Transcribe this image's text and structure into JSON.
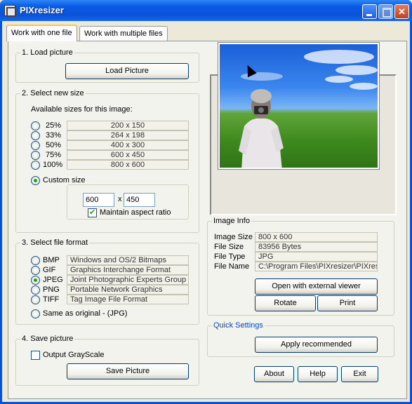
{
  "window": {
    "title": "PIXresizer"
  },
  "tabs": [
    {
      "label": "Work with one file",
      "active": true
    },
    {
      "label": "Work with multiple files",
      "active": false
    }
  ],
  "load": {
    "legend": "1. Load picture",
    "button": "Load Picture"
  },
  "size": {
    "legend": "2. Select new size",
    "caption": "Available sizes for this image:",
    "options": [
      {
        "pct": "25%",
        "dims": "200  x  150",
        "checked": false
      },
      {
        "pct": "33%",
        "dims": "264  x  198",
        "checked": false
      },
      {
        "pct": "50%",
        "dims": "400  x  300",
        "checked": false
      },
      {
        "pct": "75%",
        "dims": "600  x  450",
        "checked": false
      },
      {
        "pct": "100%",
        "dims": "800  x  600",
        "checked": false
      }
    ],
    "custom_label": "Custom size",
    "custom_checked": true,
    "custom_width": "600",
    "custom_x": "x",
    "custom_height": "450",
    "maintain_label": "Maintain aspect ratio",
    "maintain_checked": true
  },
  "format": {
    "legend": "3. Select file format",
    "options": [
      {
        "ext": "BMP",
        "desc": "Windows and OS/2 Bitmaps",
        "checked": false
      },
      {
        "ext": "GIF",
        "desc": "Graphics Interchange Format",
        "checked": false
      },
      {
        "ext": "JPEG",
        "desc": "Joint Photographic Experts Group",
        "checked": true
      },
      {
        "ext": "PNG",
        "desc": "Portable Network Graphics",
        "checked": false
      },
      {
        "ext": "TIFF",
        "desc": "Tag Image File Format",
        "checked": false
      }
    ],
    "same_as_original": "Same as original  - (JPG)"
  },
  "save": {
    "legend": "4. Save picture",
    "grayscale_label": "Output GrayScale",
    "button": "Save Picture"
  },
  "info": {
    "legend": "Image Info",
    "rows": [
      {
        "key": "Image Size",
        "value": "800 x 600"
      },
      {
        "key": "File Size",
        "value": "83956 Bytes"
      },
      {
        "key": "File Type",
        "value": "JPG"
      },
      {
        "key": "File Name",
        "value": "C:\\Program Files\\PIXresizer\\PIXresiz"
      }
    ],
    "open_button": "Open with external viewer",
    "rotate_button": "Rotate",
    "print_button": "Print"
  },
  "quick": {
    "legend": "Quick Settings",
    "button": "Apply recommended"
  },
  "footer": {
    "about": "About",
    "help": "Help",
    "exit": "Exit"
  }
}
